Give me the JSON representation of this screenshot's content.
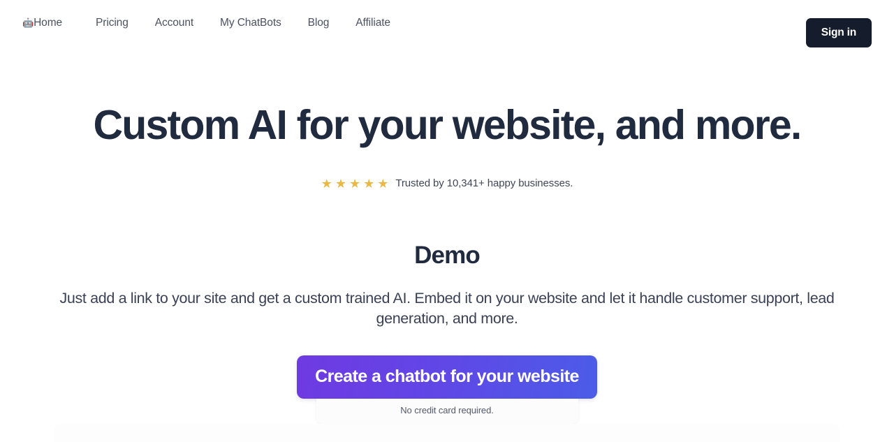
{
  "nav": {
    "home_icon": "robot-icon",
    "home_icon_glyph": "🤖",
    "items": [
      {
        "label": "Home"
      },
      {
        "label": "Pricing"
      },
      {
        "label": "Account"
      },
      {
        "label": "My ChatBots"
      },
      {
        "label": "Blog"
      },
      {
        "label": "Affiliate"
      }
    ],
    "signin_label": "Sign in"
  },
  "hero": {
    "headline": "Custom AI for your website, and more.",
    "stars": 5,
    "star_glyph": "★",
    "trust_text": "Trusted by 10,341+ happy businesses."
  },
  "demo": {
    "title": "Demo",
    "description": "Just add a link to your site and get a custom trained AI. Embed it on your website and let it handle customer support, lead generation, and more."
  },
  "cta": {
    "button_label": "Create a chatbot for your website",
    "note": "No credit card required."
  },
  "colors": {
    "ink": "#212b40",
    "muted": "#4b5161",
    "signin_bg": "#151c2c",
    "star": "#eab945",
    "cta_gradient_start": "#6f3ae2",
    "cta_gradient_end": "#4b5ce8",
    "page_bg": "#ffffff"
  }
}
